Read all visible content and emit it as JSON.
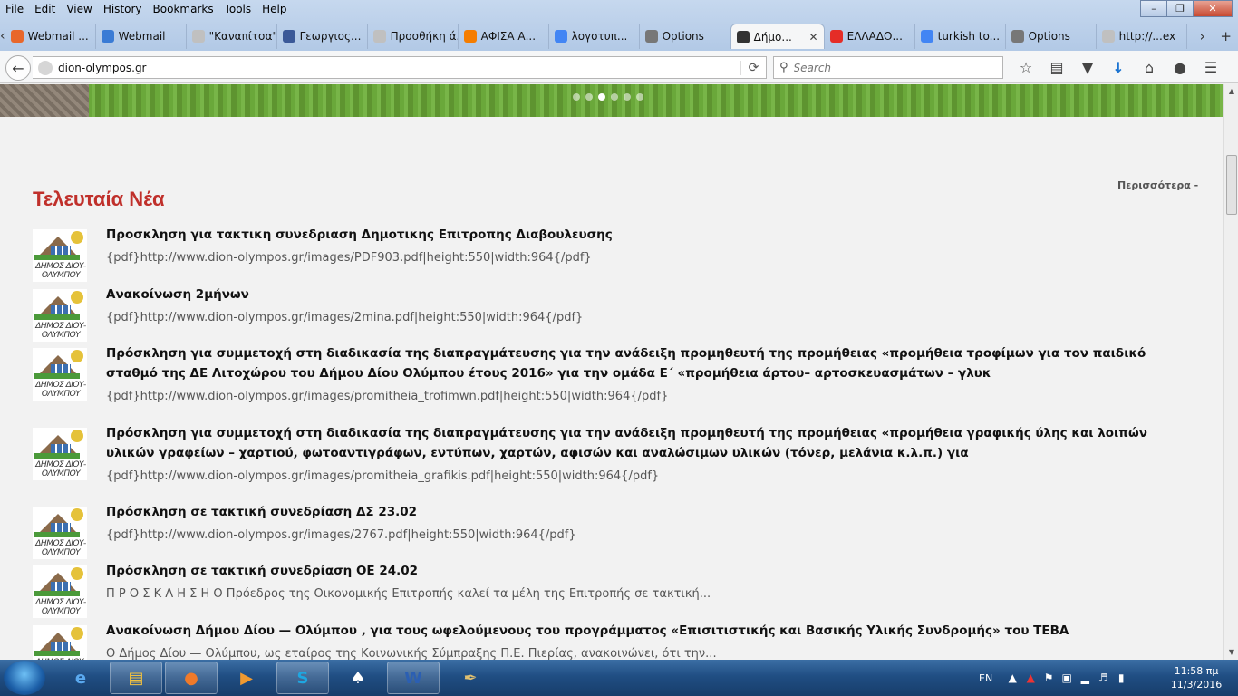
{
  "menu": [
    "File",
    "Edit",
    "View",
    "History",
    "Bookmarks",
    "Tools",
    "Help"
  ],
  "tabs": [
    {
      "label": "Webmail ...",
      "icon": "cpanel-icon",
      "color": "#e8672b"
    },
    {
      "label": "Webmail",
      "icon": "globe-icon",
      "color": "#3a7bd5"
    },
    {
      "label": "\"Καναπίτσα\" ...",
      "icon": "blank-icon",
      "color": "#c0c0c0"
    },
    {
      "label": "Γεωργιος...",
      "icon": "facebook-icon",
      "color": "#3b5998"
    },
    {
      "label": "Προσθήκη ά...",
      "icon": "blank-icon",
      "color": "#c0c0c0"
    },
    {
      "label": "ΑΦΙΣΑ Α...",
      "icon": "blogger-icon",
      "color": "#f57d00"
    },
    {
      "label": "λογοτυπ...",
      "icon": "google-icon",
      "color": "#4285f4"
    },
    {
      "label": "Options",
      "icon": "gear-icon",
      "color": "#777777"
    },
    {
      "label": "Δήμο...",
      "icon": "site-icon",
      "color": "#333333",
      "active": true
    },
    {
      "label": "ΕΛΛΑΔΟ...",
      "icon": "youtube-icon",
      "color": "#e52d27"
    },
    {
      "label": "turkish to...",
      "icon": "google-icon",
      "color": "#4285f4"
    },
    {
      "label": "Options",
      "icon": "gear-icon",
      "color": "#777777"
    },
    {
      "label": "http://...ex",
      "icon": "blank-icon",
      "color": "#c0c0c0"
    }
  ],
  "nav": {
    "url": "dion-olympos.gr",
    "search_placeholder": "Search"
  },
  "content": {
    "section_title": "Τελευταία Νέα",
    "more_link": "Περισσότερα -",
    "thumb_label": "ΔΗΜΟΣ ΔΙΟΥ-ΟΛΥΜΠΟΥ",
    "news": [
      {
        "headline": "Προσκληση για τακτικη συνεδριαση Δημοτικης Επιτροπης Διαβουλευσης",
        "excerpt": "{pdf}http://www.dion-olympos.gr/images/PDF903.pdf|height:550|width:964{/pdf}"
      },
      {
        "headline": "Ανακοίνωση 2μήνων",
        "excerpt": "{pdf}http://www.dion-olympos.gr/images/2mina.pdf|height:550|width:964{/pdf}"
      },
      {
        "headline": "Πρόσκληση για συμμετοχή στη διαδικασία της διαπραγμάτευσης για την ανάδειξη προμηθευτή της προμήθειας «προμήθεια τροφίμων για τον παιδικό σταθμό της ΔΕ Λιτοχώρου του Δήμου Δίου Ολύμπου έτους 2016» για την ομάδα Ε΄ «προμήθεια άρτου– αρτοσκευασμάτων – γλυκ",
        "excerpt": "{pdf}http://www.dion-olympos.gr/images/promitheia_trofimwn.pdf|height:550|width:964{/pdf}"
      },
      {
        "headline": "Πρόσκληση για συμμετοχή στη διαδικασία της διαπραγμάτευσης για την ανάδειξη προμηθευτή της προμήθειας «προμήθεια γραφικής ύλης και λοιπών υλικών γραφείων – χαρτιού, φωτοαντιγράφων, εντύπων, χαρτών, αφισών και αναλώσιμων υλικών (τόνερ, μελάνια κ.λ.π.) για",
        "excerpt": "{pdf}http://www.dion-olympos.gr/images/promitheia_grafikis.pdf|height:550|width:964{/pdf}"
      },
      {
        "headline": "Πρόσκληση σε τακτική συνεδρίαση ΔΣ 23.02",
        "excerpt": "{pdf}http://www.dion-olympos.gr/images/2767.pdf|height:550|width:964{/pdf}"
      },
      {
        "headline": "Πρόσκληση σε τακτική συνεδρίαση ΟΕ 24.02",
        "excerpt": "Π Ρ Ο Σ Κ Λ Η Σ Η Ο Πρόεδρος της Οικονομικής Επιτροπής καλεί τα μέλη της Επιτροπής σε τακτική..."
      },
      {
        "headline": "Ανακοίνωση Δήμου Δίου — Ολύμπου , για τους ωφελούμενους του προγράμματος «Επισιτιστικής και Βασικής Υλικής Συνδρομής» του ΤΕΒΑ",
        "excerpt": "Ο Δήμος Δίου — Ολύμπου, ως εταίρος της Κοινωνικής Σύμπραξης Π.Ε. Πιερίας, ανακοινώνει, ότι την..."
      }
    ]
  },
  "taskbar": {
    "apps": [
      "ie-icon",
      "explorer-icon",
      "firefox-icon",
      "media-player-icon",
      "skype-icon",
      "solitaire-icon",
      "word-icon",
      "paint-icon"
    ],
    "language": "EN",
    "time": "11:58 πμ",
    "date": "11/3/2016"
  }
}
